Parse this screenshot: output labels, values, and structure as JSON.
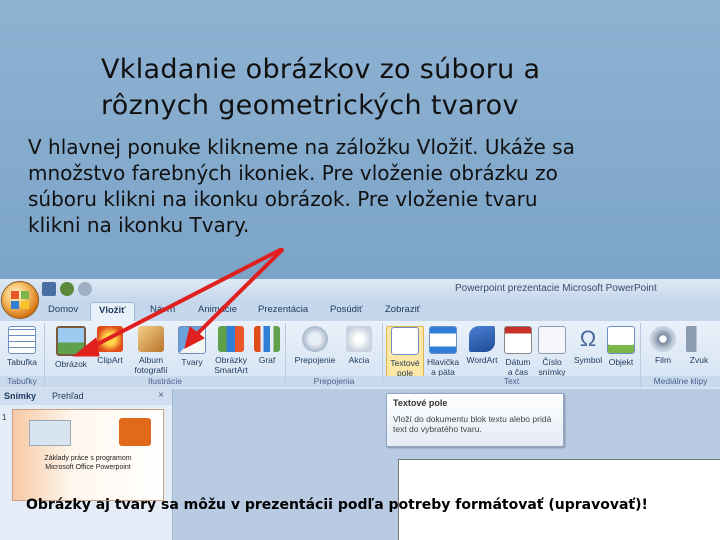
{
  "slide": {
    "title_line1": "Vkladanie obrázkov zo súboru a",
    "title_line2": "rôznych geometrických tvarov",
    "body_line1": "V hlavnej ponuke klikneme na záložku Vložiť. Ukáže sa",
    "body_line2": "množstvo farebných ikoniek. Pre vloženie obrázku zo",
    "body_line3": "súboru klikni na ikonku obrázok. Pre vloženie tvaru",
    "body_line4": "klikni na ikonku Tvary.",
    "footer_note": "Obrázky aj tvary sa môžu v prezentácii podľa potreby formátovať (upravovať)!"
  },
  "app": {
    "window_title": "Powerpoint prezentacie   Microsoft PowerPoint",
    "tabs": [
      "Domov",
      "Vložiť",
      "Návrh",
      "Animácie",
      "Prezentácia",
      "Posúdiť",
      "Zobraziť"
    ],
    "active_tab": "Vložiť"
  },
  "ribbon": {
    "groups": {
      "tables": "Tabuľky",
      "illustrations": "Ilustrácie",
      "links": "Prepojenia",
      "text": "Text",
      "media": "Mediálne klipy"
    },
    "buttons": {
      "table": "Tabuľka",
      "picture": "Obrázok",
      "clipart": "ClipArt",
      "album_l1": "Album",
      "album_l2": "fotografií",
      "shapes": "Tvary",
      "smartart_l1": "Obrázky",
      "smartart_l2": "SmartArt",
      "chart": "Graf",
      "hyperlink": "Prepojenie",
      "action": "Akcia",
      "textbox_l1": "Textové",
      "textbox_l2": "pole",
      "header_l1": "Hlavička",
      "header_l2": "a päta",
      "wordart": "WordArt",
      "date_l1": "Dátum",
      "date_l2": "a čas",
      "slidenum_l1": "Číslo",
      "slidenum_l2": "snímky",
      "symbol": "Symbol",
      "object": "Objekt",
      "movie": "Film",
      "sound": "Zvuk"
    }
  },
  "pane": {
    "tab_slides": "Snímky",
    "tab_outline": "Prehľad",
    "close": "×",
    "slide_number": "1",
    "thumb_text_l1": "Základy práce s programom",
    "thumb_text_l2": "Microsoft Office Powerpoint"
  },
  "tooltip": {
    "title": "Textové pole",
    "body": "Vloží do dokumentu blok textu alebo pridá text do vybratého tvaru."
  },
  "colors": {
    "background": "#7ea6c9",
    "arrow": "#e0201e",
    "ribbon": "#dfe9f5"
  }
}
